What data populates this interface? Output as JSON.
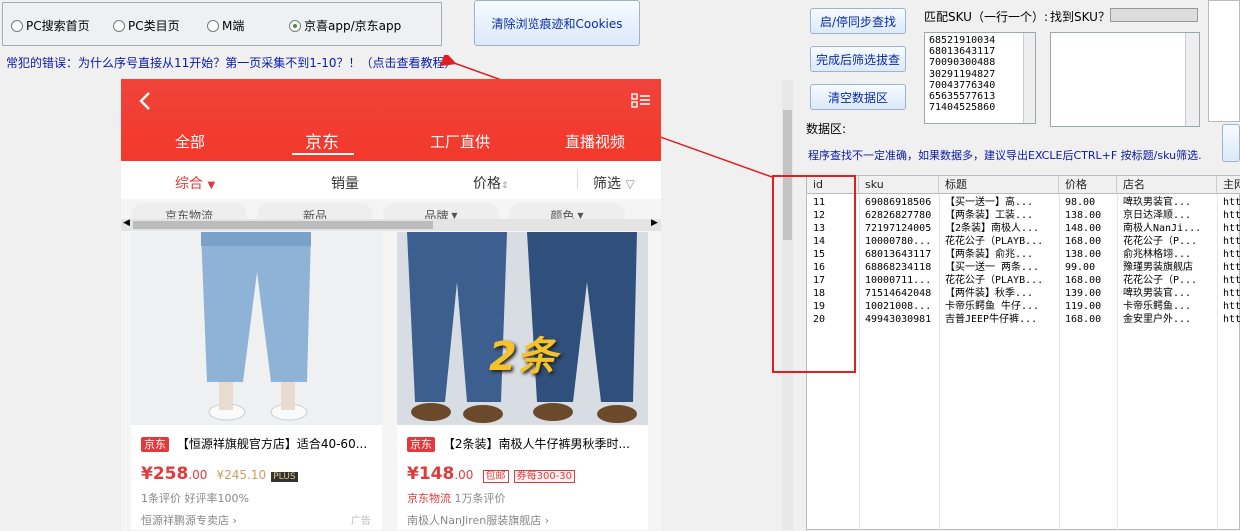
{
  "radios": [
    {
      "label": "PC搜索首页",
      "checked": false
    },
    {
      "label": "PC类目页",
      "checked": false
    },
    {
      "label": "M端",
      "checked": false
    },
    {
      "label": "京喜app/京东app",
      "checked": true
    }
  ],
  "clear_button": "清除浏览痕迹和Cookies",
  "tutorial_link": "常犯的错误：为什么序号直接从11开始？第一页采集不到1-10？！（点击查看教程）",
  "phone": {
    "tabs": [
      "全部",
      "京东",
      "工厂直供",
      "直播视频"
    ],
    "filters": [
      "综合",
      "销量",
      "价格",
      "筛选"
    ],
    "chips": [
      "京东物流",
      "新品",
      "品牌",
      "颜色"
    ],
    "products": [
      {
        "tag": "京东",
        "title": "【恒源祥旗舰官方店】适合40-60...",
        "price": "¥258",
        "price_dec": ".00",
        "old_price": "¥245.10",
        "plus": "PLUS",
        "meta": "1条评价 好评率100%",
        "shop": "恒源祥鹏源专卖店 ›",
        "ad": "广告"
      },
      {
        "tag": "京东",
        "title": "【2条装】南极人牛仔裤男秋季时...",
        "price": "¥148",
        "price_dec": ".00",
        "badge1": "包邮",
        "badge2": "券每300-30",
        "meta_tag": "京东物流",
        "meta": "1万条评价",
        "shop": "南极人NanJiren服装旗舰店 ›",
        "image_text": "2条"
      }
    ]
  },
  "right": {
    "btn_toggle": "启/停同步查找",
    "btn_filter": "完成后筛选拔查",
    "btn_clear": "清空数据区",
    "match_label": "匹配SKU（一行一个）:",
    "found_label": "找到SKU？",
    "sku_list": [
      "68521910034",
      "68013643117",
      "70090300488",
      "30291194827",
      "70043776340",
      "65635577613",
      "71404525860"
    ],
    "data_label": "数据区:",
    "tip": "程序查找不一定准确，如果数据多，建议导出EXCLE后CTRL+F 按标题/sku筛选."
  },
  "table": {
    "headers": [
      "id",
      "sku",
      "标题",
      "价格",
      "店名",
      "主网"
    ],
    "rows": [
      [
        "11",
        "69086918506",
        "【买一送一】高...",
        "98.00",
        "啤玖男装官...",
        "htt"
      ],
      [
        "12",
        "62826827780",
        "【两条装】工装...",
        "138.00",
        "京日达泽顺...",
        "htt"
      ],
      [
        "13",
        "72197124005",
        "【2条装】南极人...",
        "148.00",
        "南极人NanJi...",
        "htt"
      ],
      [
        "14",
        "10000780...",
        "花花公子（PLAYB...",
        "168.00",
        "花花公子（P...",
        "htt"
      ],
      [
        "15",
        "68013643117",
        "【两条装】俞兆...",
        "138.00",
        "俞兆林格翊...",
        "htt"
      ],
      [
        "16",
        "68868234118",
        "【买一送一 两条...",
        "99.00",
        "豫瑾男装旗舰店",
        "htt"
      ],
      [
        "17",
        "10000711...",
        "花花公子（PLAYB...",
        "168.00",
        "花花公子（P...",
        "htt"
      ],
      [
        "18",
        "71514642048",
        "【两件装】秋季...",
        "139.00",
        "啤玖男装官...",
        "htt"
      ],
      [
        "19",
        "10021008...",
        "卡帝乐鳄鱼 牛仔...",
        "119.00",
        "卡帝乐鳄鱼...",
        "htt"
      ],
      [
        "20",
        "49943030981",
        "吉普JEEP牛仔裤...",
        "168.00",
        "金安里户外...",
        "htt"
      ]
    ]
  },
  "colors": {
    "accent_red": "#f3382b",
    "link_blue": "#0a1aa8",
    "highlight_red": "#e02020"
  }
}
